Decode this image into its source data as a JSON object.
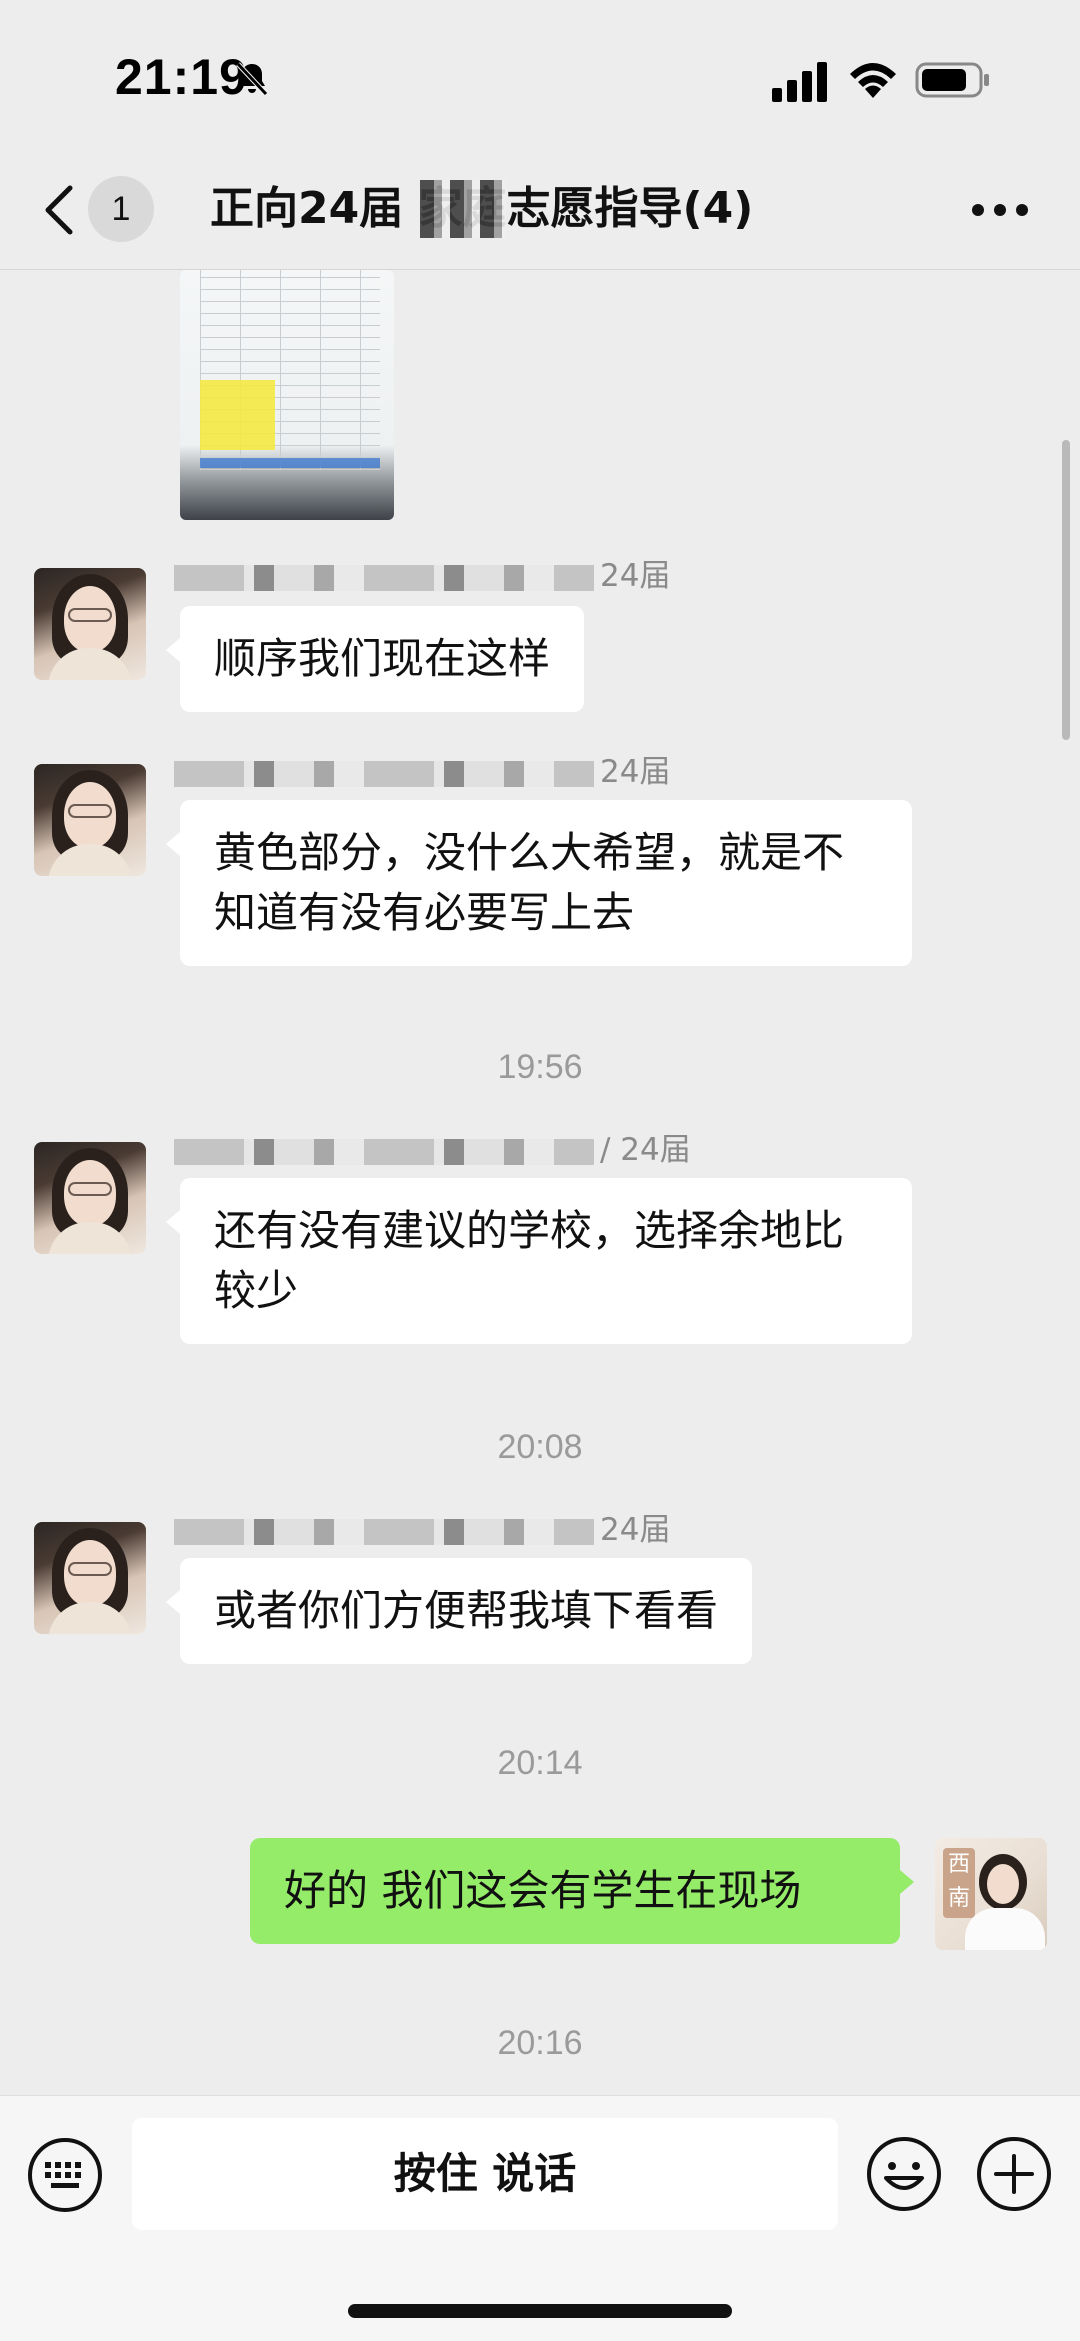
{
  "status_bar": {
    "time": "21:19",
    "icons": [
      "bell-muted-icon",
      "signal-icon",
      "wifi-icon",
      "battery-icon"
    ]
  },
  "nav": {
    "back_icon": "chevron-left-icon",
    "unread_count": "1",
    "title": "正向24届    家庭志愿指导(4)",
    "more_icon": "more-dots-icon"
  },
  "messages": [
    {
      "type": "image",
      "side": "left",
      "content": "spreadsheet-photo"
    },
    {
      "type": "text",
      "side": "left",
      "sender_suffix": "24届",
      "text": "顺序我们现在这样"
    },
    {
      "type": "text",
      "side": "left",
      "sender_suffix": "24届",
      "text": "黄色部分，没什么大希望，就是不知道有没有必要写上去"
    },
    {
      "type": "time",
      "text": "19:56"
    },
    {
      "type": "text",
      "side": "left",
      "sender_suffix": "/ 24届",
      "text": "还有没有建议的学校，选择余地比较少"
    },
    {
      "type": "time",
      "text": "20:08"
    },
    {
      "type": "text",
      "side": "left",
      "sender_suffix": "24届",
      "text": "或者你们方便帮我填下看看"
    },
    {
      "type": "time",
      "text": "20:14"
    },
    {
      "type": "text",
      "side": "right",
      "text": "好的 我们这会有学生在现场"
    },
    {
      "type": "time",
      "text": "20:16"
    }
  ],
  "my_avatar_tag": "西南",
  "input_bar": {
    "hold_to_talk": "按住 说话",
    "icons": [
      "keyboard-icon",
      "emoji-icon",
      "plus-icon"
    ]
  },
  "colors": {
    "background": "#ededed",
    "my_bubble": "#95ec69",
    "other_bubble": "#ffffff"
  }
}
